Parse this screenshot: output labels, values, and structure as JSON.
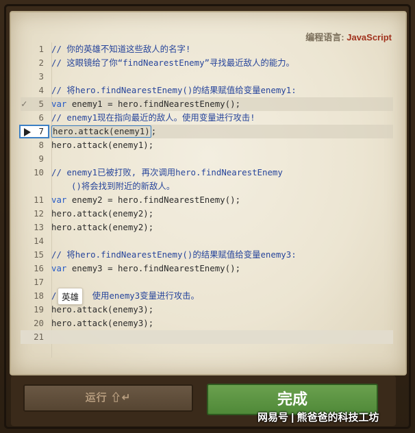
{
  "language": {
    "label": "编程语言:",
    "value": "JavaScript"
  },
  "code_lines": [
    {
      "num": "1",
      "text": "// 你的英雄不知道这些敌人的名字!",
      "type": "comment"
    },
    {
      "num": "2",
      "text": "// 这眼镜给了你“findNearestEnemy”寻找最近敌人的能力。",
      "type": "comment"
    },
    {
      "num": "3",
      "text": "",
      "type": "blank"
    },
    {
      "num": "4",
      "text": "// 将hero.findNearestEnemy()的结果赋值给变量enemy1:",
      "type": "comment"
    },
    {
      "num": "5",
      "kw": "var",
      "text": " enemy1 = hero.findNearestEnemy();",
      "type": "code"
    },
    {
      "num": "6",
      "text": "// enemy1现在指向最近的敌人。使用变量进行攻击!",
      "type": "comment"
    },
    {
      "num": "7",
      "text": "hero.attack(enemy1)",
      "suffix": ";",
      "type": "code"
    },
    {
      "num": "8",
      "text": "hero.attack(enemy1);",
      "type": "code"
    },
    {
      "num": "9",
      "text": "",
      "type": "blank"
    },
    {
      "num": "10",
      "text": "// enemy1已被打败, 再次调用hero.findNearestEnemy",
      "cont": "()将会找到附近的新敌人。",
      "type": "comment"
    },
    {
      "num": "11",
      "kw": "var",
      "text": " enemy2 = hero.findNearestEnemy();",
      "type": "code"
    },
    {
      "num": "12",
      "text": "hero.attack(enemy2);",
      "type": "code"
    },
    {
      "num": "13",
      "text": "hero.attack(enemy2);",
      "type": "code"
    },
    {
      "num": "14",
      "text": "",
      "type": "blank"
    },
    {
      "num": "15",
      "text": "// 将hero.findNearestEnemy()的结果赋值给变量enemy3:",
      "type": "comment"
    },
    {
      "num": "16",
      "kw": "var",
      "text": " enemy3 = hero.findNearestEnemy();",
      "type": "code"
    },
    {
      "num": "17",
      "text": "",
      "type": "blank"
    },
    {
      "num": "18",
      "text": "/       使用enemy3变量进行攻击。",
      "type": "comment"
    },
    {
      "num": "19",
      "text": "hero.attack(enemy3);",
      "type": "code"
    },
    {
      "num": "20",
      "text": "hero.attack(enemy3);",
      "type": "code"
    },
    {
      "num": "21",
      "text": "",
      "type": "blank"
    }
  ],
  "tooltip": "英雄",
  "buttons": {
    "run": "运行 ⇧↵",
    "done": "完成"
  },
  "watermark": "网易号 | 熊爸爸的科技工坊",
  "colors": {
    "comment": "#27459b",
    "keyword": "#2459c6",
    "done_green": "#5a9642",
    "brand_red": "#a0311c"
  }
}
